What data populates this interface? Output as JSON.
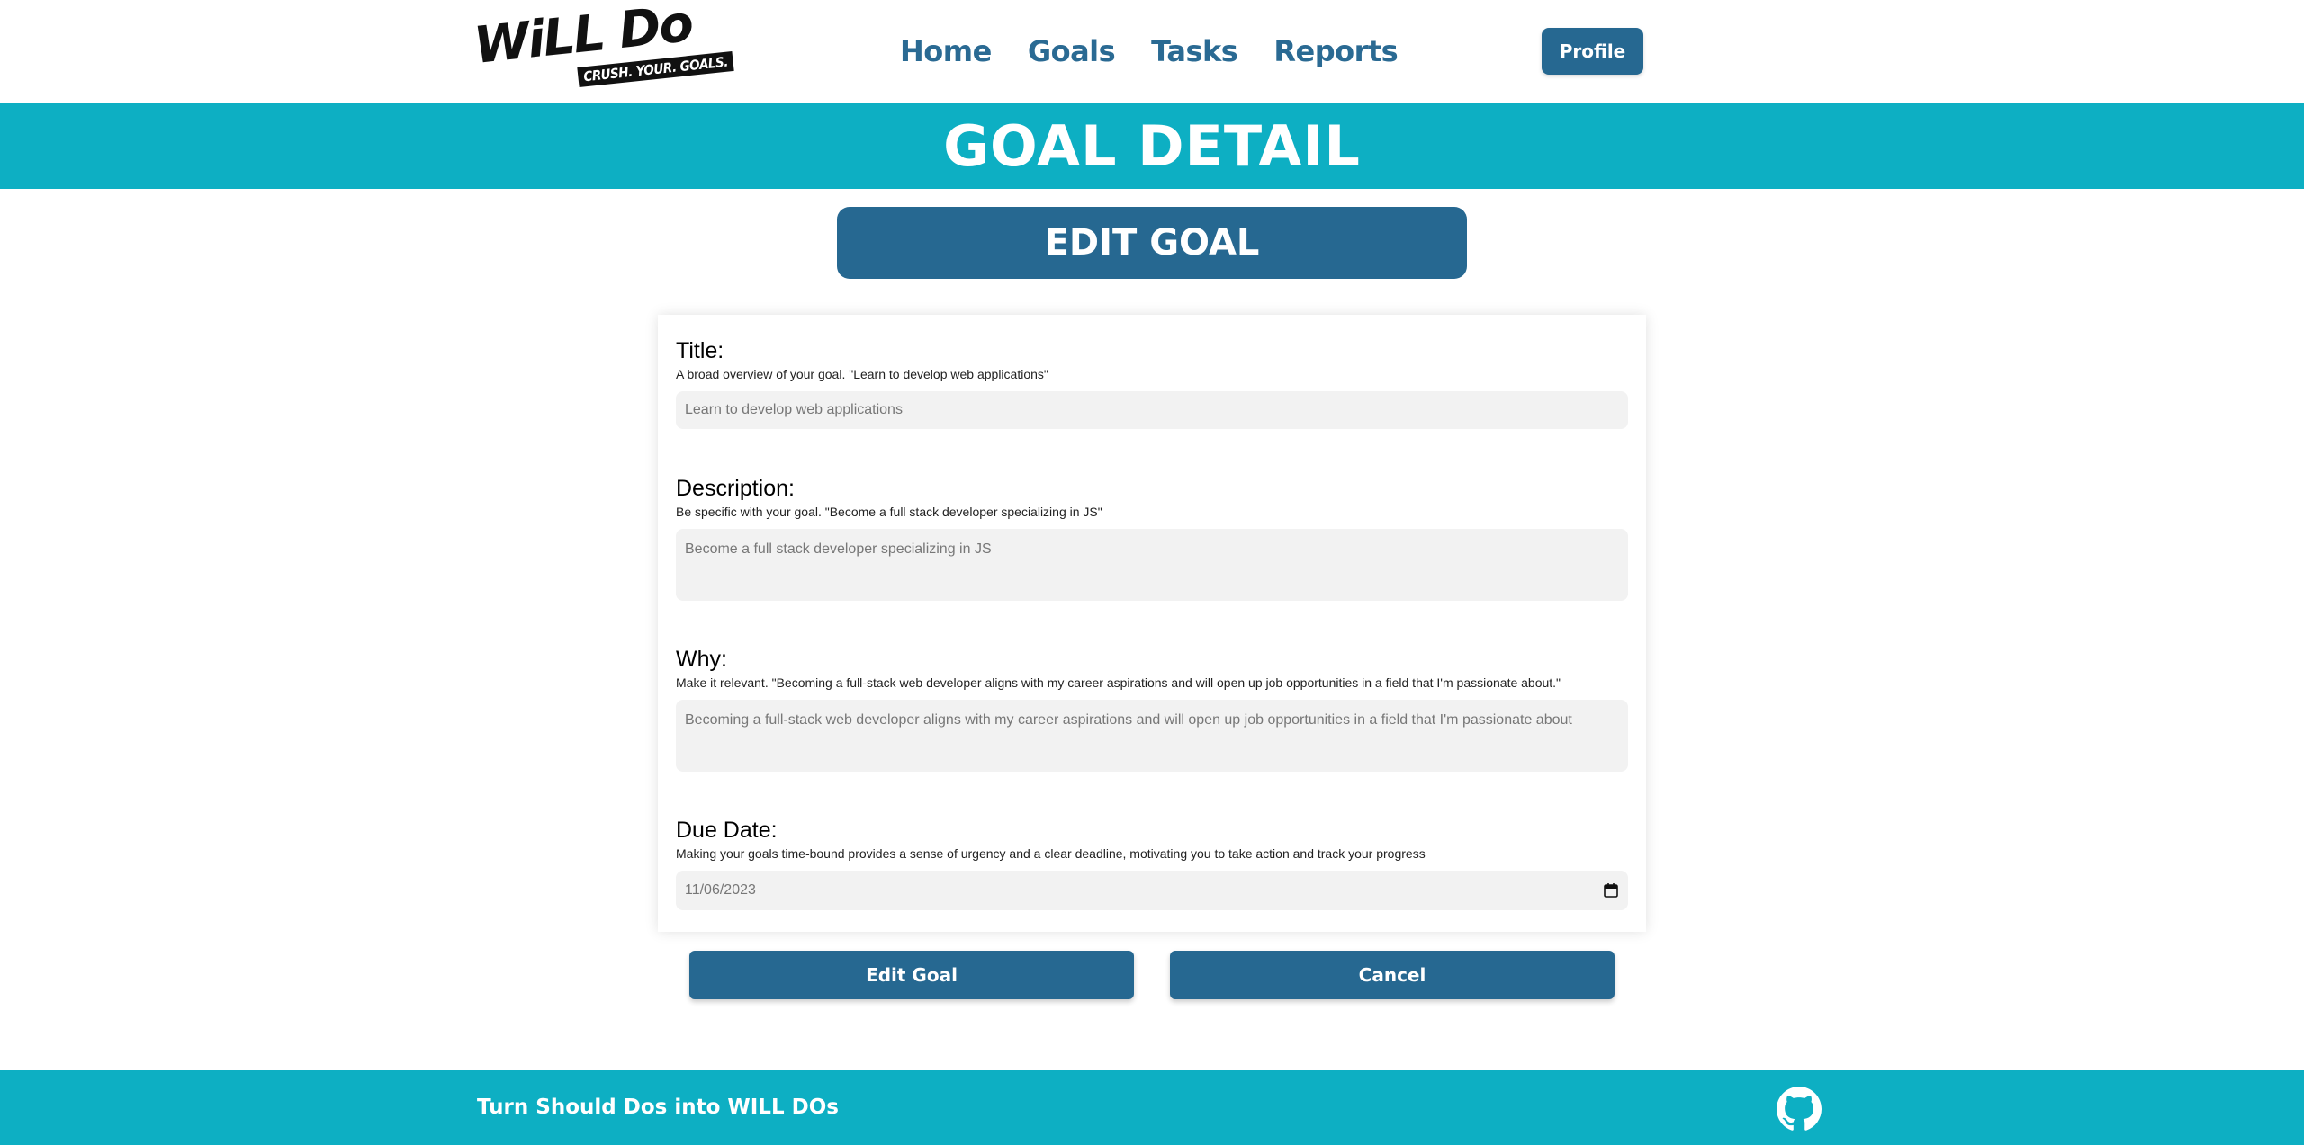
{
  "header": {
    "logo_text": "WiLL Do",
    "logo_tagline": "CRUSH. YOUR. GOALS.",
    "nav": [
      {
        "label": "Home"
      },
      {
        "label": "Goals"
      },
      {
        "label": "Tasks"
      },
      {
        "label": "Reports"
      }
    ],
    "profile_label": "Profile"
  },
  "banner": {
    "title": "GOAL DETAIL"
  },
  "edit_header": {
    "title": "EDIT GOAL"
  },
  "form": {
    "title": {
      "label": "Title:",
      "hint": "A broad overview of your goal. \"Learn to develop web applications\"",
      "value": "Learn to develop web applications"
    },
    "description": {
      "label": "Description:",
      "hint": "Be specific with your goal. \"Become a full stack developer specializing in JS\"",
      "value": "Become a full stack developer specializing in JS"
    },
    "why": {
      "label": "Why:",
      "hint": "Make it relevant. \"Becoming a full-stack web developer aligns with my career aspirations and will open up job opportunities in a field that I'm passionate about.\"",
      "value": "Becoming a full-stack web developer aligns with my career aspirations and will open up job opportunities in a field that I'm passionate about"
    },
    "due_date": {
      "label": "Due Date:",
      "hint": "Making your goals time-bound provides a sense of urgency and a clear deadline, motivating you to take action and track your progress",
      "value": "11/06/2023"
    }
  },
  "actions": {
    "edit_label": "Edit Goal",
    "cancel_label": "Cancel"
  },
  "footer": {
    "text": "Turn Should Dos into WILL DOs"
  },
  "colors": {
    "primary": "#266891",
    "accent": "#0dafc3",
    "input_bg": "#f2f2f2"
  },
  "icons": {
    "calendar": "calendar-icon",
    "github": "github-icon"
  }
}
